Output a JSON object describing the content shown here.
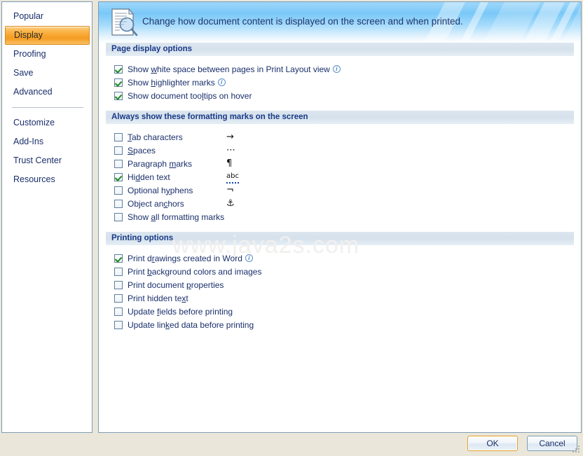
{
  "sidebar": {
    "items": [
      {
        "label": "Popular",
        "selected": false
      },
      {
        "label": "Display",
        "selected": true
      },
      {
        "label": "Proofing",
        "selected": false
      },
      {
        "label": "Save",
        "selected": false
      },
      {
        "label": "Advanced",
        "selected": false
      }
    ],
    "items_after_separator": [
      {
        "label": "Customize",
        "selected": false
      },
      {
        "label": "Add-Ins",
        "selected": false
      },
      {
        "label": "Trust Center",
        "selected": false
      },
      {
        "label": "Resources",
        "selected": false
      }
    ]
  },
  "banner": {
    "icon": "document-magnifier-icon",
    "text": "Change how document content is displayed on the screen and when printed."
  },
  "sections": [
    {
      "id": "page-display-options",
      "title": "Page display options",
      "options": [
        {
          "label_pre": "Show ",
          "accel": "w",
          "label_post": "hite space between pages in Print Layout view",
          "checked": true,
          "info": true,
          "glyph": ""
        },
        {
          "label_pre": "Show ",
          "accel": "h",
          "label_post": "ighlighter marks",
          "checked": true,
          "info": true,
          "glyph": ""
        },
        {
          "label_pre": "Show document too",
          "accel": "l",
          "label_post": "tips on hover",
          "checked": true,
          "info": false,
          "glyph": ""
        }
      ]
    },
    {
      "id": "formatting-marks",
      "title": "Always show these formatting marks on the screen",
      "options": [
        {
          "label_pre": "",
          "accel": "T",
          "label_post": "ab characters",
          "checked": false,
          "info": false,
          "glyph": "→"
        },
        {
          "label_pre": "",
          "accel": "S",
          "label_post": "paces",
          "checked": false,
          "info": false,
          "glyph": "⋯"
        },
        {
          "label_pre": "Paragraph ",
          "accel": "m",
          "label_post": "arks",
          "checked": false,
          "info": false,
          "glyph": "¶"
        },
        {
          "label_pre": "Hi",
          "accel": "d",
          "label_post": "den text",
          "checked": true,
          "info": false,
          "glyph": "abc"
        },
        {
          "label_pre": "Optional h",
          "accel": "y",
          "label_post": "phens",
          "checked": false,
          "info": false,
          "glyph": "¬"
        },
        {
          "label_pre": "Object an",
          "accel": "c",
          "label_post": "hors",
          "checked": false,
          "info": false,
          "glyph": "⚓"
        },
        {
          "label_pre": "Show ",
          "accel": "a",
          "label_post": "ll formatting marks",
          "checked": false,
          "info": false,
          "glyph": ""
        }
      ]
    },
    {
      "id": "printing-options",
      "title": "Printing options",
      "options": [
        {
          "label_pre": "Print d",
          "accel": "r",
          "label_post": "awings created in Word",
          "checked": true,
          "info": true,
          "glyph": ""
        },
        {
          "label_pre": "Print ",
          "accel": "b",
          "label_post": "ackground colors and images",
          "checked": false,
          "info": false,
          "glyph": ""
        },
        {
          "label_pre": "Print document ",
          "accel": "p",
          "label_post": "roperties",
          "checked": false,
          "info": false,
          "glyph": ""
        },
        {
          "label_pre": "Print hidden te",
          "accel": "x",
          "label_post": "t",
          "checked": false,
          "info": false,
          "glyph": ""
        },
        {
          "label_pre": "Update ",
          "accel": "f",
          "label_post": "ields before printing",
          "checked": false,
          "info": false,
          "glyph": ""
        },
        {
          "label_pre": "Update lin",
          "accel": "k",
          "label_post": "ed data before printing",
          "checked": false,
          "info": false,
          "glyph": ""
        }
      ]
    }
  ],
  "watermark": "www.java2s.com",
  "footer": {
    "ok_label": "OK",
    "cancel_label": "Cancel"
  },
  "colors": {
    "accent_orange": "#f7a52f",
    "text_navy": "#1a2f6b",
    "section_header_text": "#1a3a86",
    "banner_blue": "#79c8f7",
    "dialog_bg": "#eae7da",
    "check_green": "#1e8a1e"
  }
}
